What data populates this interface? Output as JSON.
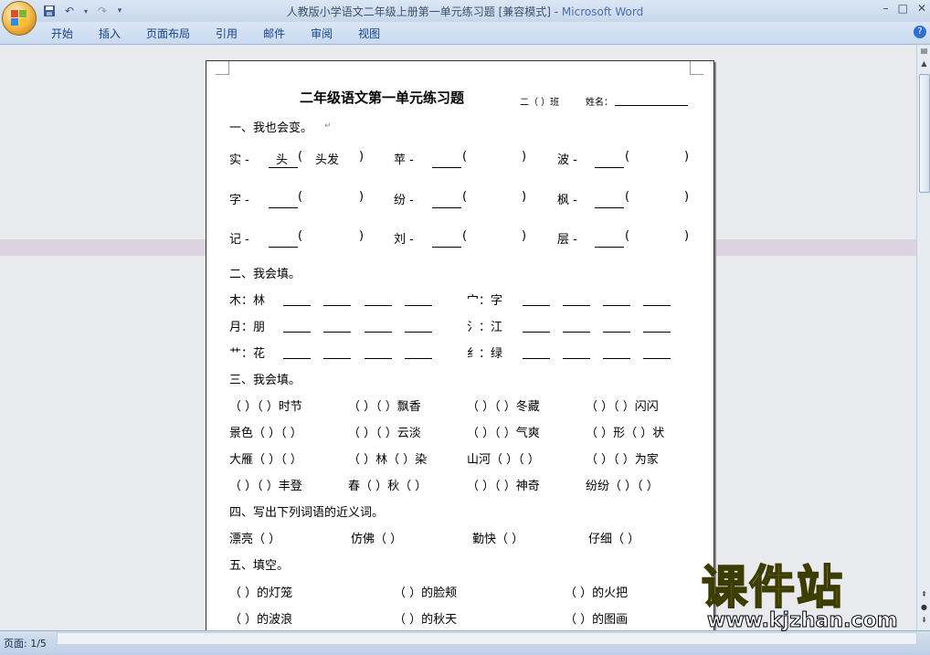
{
  "window": {
    "title": "人教版小学语文二年级上册第一单元练习题 [兼容模式] - ",
    "app_name": "Microsoft Word",
    "controls": [
      "–",
      "□",
      "✕"
    ]
  },
  "ribbon": {
    "tabs": [
      "开始",
      "插入",
      "页面布局",
      "引用",
      "邮件",
      "审阅",
      "视图"
    ],
    "help": "?"
  },
  "status": {
    "page": "页面: 1/5"
  },
  "doc": {
    "title": "二年级语文第一单元练习题",
    "class_label": "二（  ）班",
    "name_label": "姓名：",
    "s1_heading": "一、我也会变。",
    "s1": [
      [
        "实 -",
        "头",
        "(",
        "头发",
        ")"
      ],
      [
        "苹 -",
        "",
        "(",
        "",
        ")"
      ],
      [
        "波 -",
        "",
        "(",
        "",
        ")"
      ],
      [
        "字 -",
        "",
        "(",
        "",
        ")"
      ],
      [
        "纷 -",
        "",
        "(",
        "",
        ")"
      ],
      [
        "枫 -",
        "",
        "(",
        "",
        ")"
      ],
      [
        "记 -",
        "",
        "(",
        "",
        ")"
      ],
      [
        "刘 -",
        "",
        "(",
        "",
        ")"
      ],
      [
        "层 -",
        "",
        "(",
        "",
        ")"
      ]
    ],
    "s2_heading": "二、我会填。",
    "s2_left": [
      "木：林",
      "月：朋",
      "艹：花"
    ],
    "s2_right": [
      "宀：字",
      "氵：江",
      "纟：绿"
    ],
    "s3_heading": "三、我会填。",
    "s3_rows": [
      [
        "（    ）（    ）时节",
        "（    ）（    ）飘香",
        "（    ）（    ）冬藏",
        "（    ）（    ）闪闪"
      ],
      [
        "景色（    ）（    ）",
        "（    ）（    ）云淡",
        "（    ）（    ）气爽",
        "（    ）形（    ）状"
      ],
      [
        "大雁（    ）（    ）",
        "（    ）林（    ）染",
        "山河（    ）（    ）",
        "（    ）（    ）为家"
      ],
      [
        "（    ）（    ）丰登",
        "春（    ）秋（    ）",
        "（    ）（    ）神奇",
        "纷纷（    ）（    ）"
      ]
    ],
    "s4_heading": "四、写出下列词语的近义词。",
    "s4": [
      "漂亮（          ）",
      "仿佛（          ）",
      "勤快（          ）",
      "仔细（          ）"
    ],
    "s5_heading": "五、填空。",
    "s5_rows": [
      [
        "（          ）的灯笼",
        "（          ）的脸颊",
        "（          ）的火把"
      ],
      [
        "（          ）的波浪",
        "（          ）的秋天",
        "（          ）的图画"
      ]
    ],
    "para_mark": "↵"
  },
  "watermark": {
    "cn": "课件站",
    "en": "www.kjzhan.com"
  }
}
